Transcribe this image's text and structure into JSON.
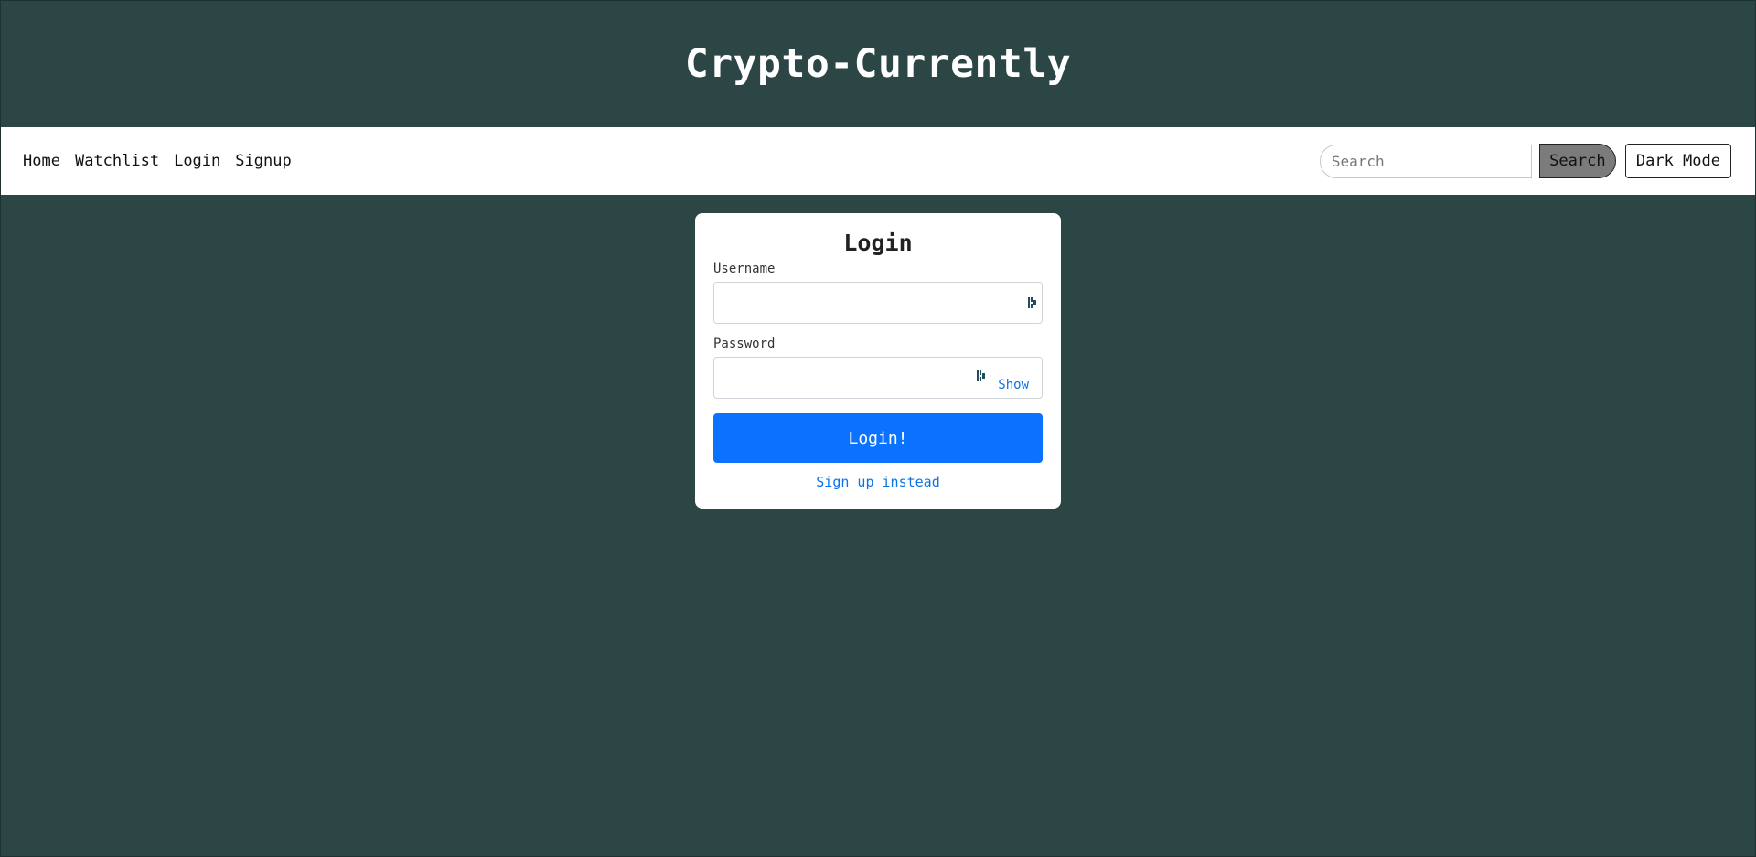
{
  "site": {
    "title": "Crypto-Currently"
  },
  "nav": {
    "links": [
      {
        "label": "Home"
      },
      {
        "label": "Watchlist"
      },
      {
        "label": "Login"
      },
      {
        "label": "Signup"
      }
    ],
    "search": {
      "placeholder": "Search",
      "button_label": "Search"
    },
    "dark_mode_label": "Dark Mode"
  },
  "login_form": {
    "title": "Login",
    "username_label": "Username",
    "username_value": "",
    "password_label": "Password",
    "password_value": "",
    "show_label": "Show",
    "submit_label": "Login!",
    "signup_link_label": "Sign up instead",
    "password_manager_icon": "password-manager-icon"
  },
  "colors": {
    "background": "#2c4646",
    "primary_button": "#0a72ff",
    "link": "#0a74e6",
    "search_button": "#7b7b7b"
  }
}
